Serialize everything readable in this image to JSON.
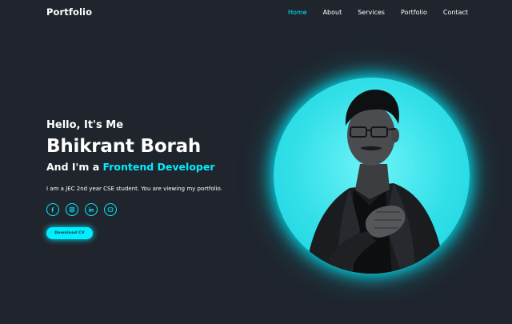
{
  "header": {
    "logo": "Portfolio",
    "nav": [
      {
        "label": "Home",
        "active": true
      },
      {
        "label": "About",
        "active": false
      },
      {
        "label": "Services",
        "active": false
      },
      {
        "label": "Portfolio",
        "active": false
      },
      {
        "label": "Contact",
        "active": false
      }
    ]
  },
  "home": {
    "greeting": "Hello, It's Me",
    "name": "Bhikrant Borah",
    "role_prefix": "And I'm a ",
    "role_highlight": "Frontend Developer",
    "description": "I am a JEC 2nd year CSE student. You are viewing my portfolio.",
    "socials": [
      {
        "icon": "facebook-icon"
      },
      {
        "icon": "instagram-icon"
      },
      {
        "icon": "linkedin-icon"
      },
      {
        "icon": "discord-icon"
      }
    ],
    "button_label": "Download CV"
  },
  "colors": {
    "background": "#1f242d",
    "accent": "#00eeff",
    "text": "#ffffff"
  }
}
